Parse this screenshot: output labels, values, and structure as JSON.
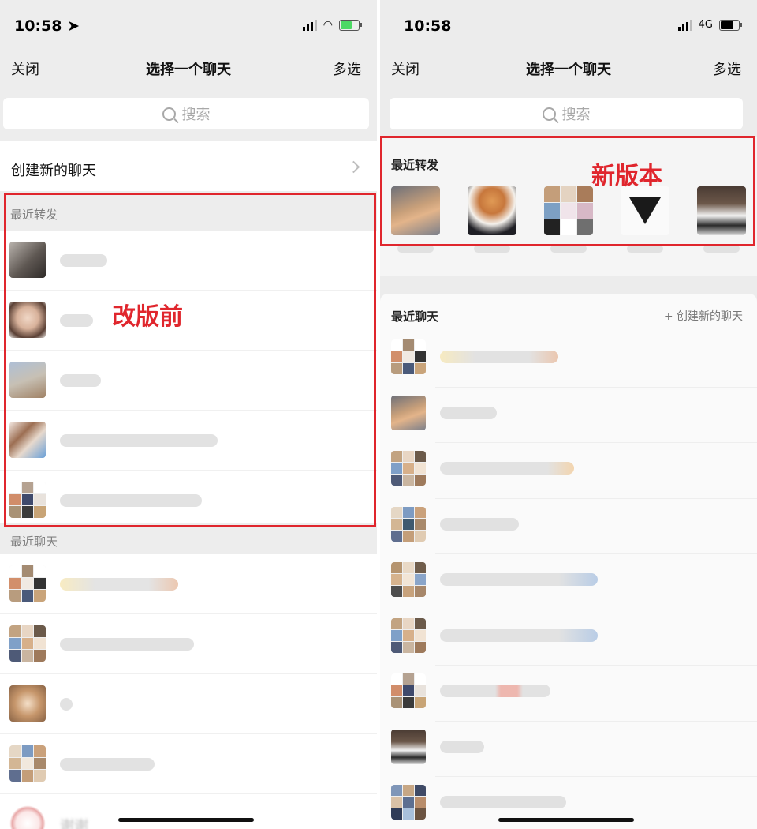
{
  "left_phone": {
    "status_time": "10:58",
    "close_label": "关闭",
    "title": "选择一个聊天",
    "multi_select_label": "多选",
    "search_placeholder": "搜索",
    "create_new_chat_label": "创建新的聊天",
    "recent_forward_label": "最近转发",
    "recent_chats_label": "最近聊天",
    "annotation": "改版前",
    "bottom_row_text": "谢谢"
  },
  "right_phone": {
    "status_time": "10:58",
    "network": "4G",
    "close_label": "关闭",
    "title": "选择一个聊天",
    "multi_select_label": "多选",
    "search_placeholder": "搜索",
    "recent_forward_label": "最近转发",
    "annotation": "新版本",
    "recent_chats_label": "最近聊天",
    "create_new_chat_label": "+ 创建新的聊天"
  },
  "colors": {
    "annotation_red": "#e0262d",
    "battery_green": "#4cd964"
  }
}
